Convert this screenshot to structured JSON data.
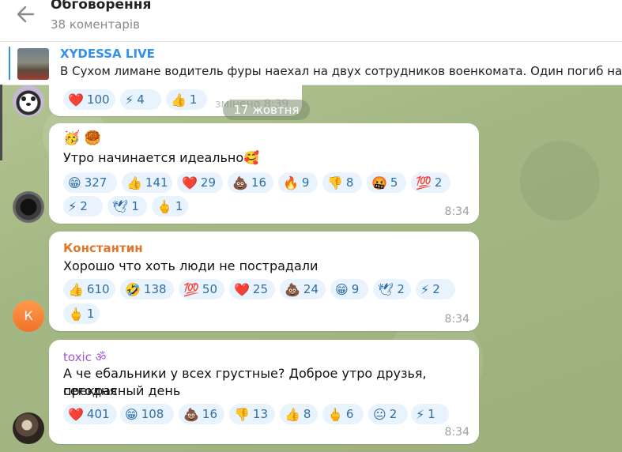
{
  "header": {
    "title": "Обговорення",
    "subtitle": "38 коментарів"
  },
  "pinned": {
    "source": "XYDESSA LIVE",
    "text": "В Сухом лимане водитель фуры наехал на двух сотрудников военкомата. Один погиб на ме"
  },
  "date_separator": "17 жовтня",
  "faint_time": "змінено 8:39",
  "top_reactions": [
    {
      "emoji": "❤️",
      "count": "100"
    },
    {
      "emoji": "⚡",
      "count": "4"
    },
    {
      "emoji": "👍",
      "count": "1"
    }
  ],
  "messages": [
    {
      "author": "",
      "line1": "🥳 🥮",
      "line2": "Утро начинается идеально🥰",
      "time": "8:34",
      "reactions": [
        {
          "emoji": "😁",
          "count": "327"
        },
        {
          "emoji": "👍",
          "count": "141"
        },
        {
          "emoji": "❤️",
          "count": "29"
        },
        {
          "emoji": "💩",
          "count": "16"
        },
        {
          "emoji": "🔥",
          "count": "9"
        },
        {
          "emoji": "👎",
          "count": "8"
        },
        {
          "emoji": "🤬",
          "count": "5"
        },
        {
          "emoji": "💯",
          "count": "2"
        },
        {
          "emoji": "⚡",
          "count": "2"
        },
        {
          "emoji": "🕊",
          "count": "1"
        },
        {
          "emoji": "🖕",
          "count": "1"
        }
      ]
    },
    {
      "author": "Константин",
      "author_color": "#e0762a",
      "text": "Хорошо что хоть люди не пострадали",
      "time": "8:34",
      "avatar_letter": "К",
      "reactions": [
        {
          "emoji": "👍",
          "count": "610"
        },
        {
          "emoji": "🤣",
          "count": "138"
        },
        {
          "emoji": "💯",
          "count": "50"
        },
        {
          "emoji": "❤️",
          "count": "25"
        },
        {
          "emoji": "💩",
          "count": "24"
        },
        {
          "emoji": "😁",
          "count": "9"
        },
        {
          "emoji": "🕊",
          "count": "2"
        },
        {
          "emoji": "⚡",
          "count": "2"
        },
        {
          "emoji": "🖕",
          "count": "1"
        }
      ]
    },
    {
      "author": "toxic ॐ",
      "author_color": "#9b59d0",
      "line1": "А че ебальники у всех грустные? Доброе утро друзья, сегодня",
      "line2": "прекрасный день",
      "time": "8:34",
      "reactions": [
        {
          "emoji": "❤️",
          "count": "401"
        },
        {
          "emoji": "😁",
          "count": "108"
        },
        {
          "emoji": "💩",
          "count": "16"
        },
        {
          "emoji": "👎",
          "count": "13"
        },
        {
          "emoji": "👍",
          "count": "8"
        },
        {
          "emoji": "🖕",
          "count": "6"
        },
        {
          "emoji": "😐",
          "count": "2"
        },
        {
          "emoji": "⚡",
          "count": "1"
        }
      ]
    }
  ],
  "colors": {
    "accent": "#3390ec",
    "reaction_bg": "#e9f3fd",
    "reaction_text": "#2f6ea5"
  }
}
